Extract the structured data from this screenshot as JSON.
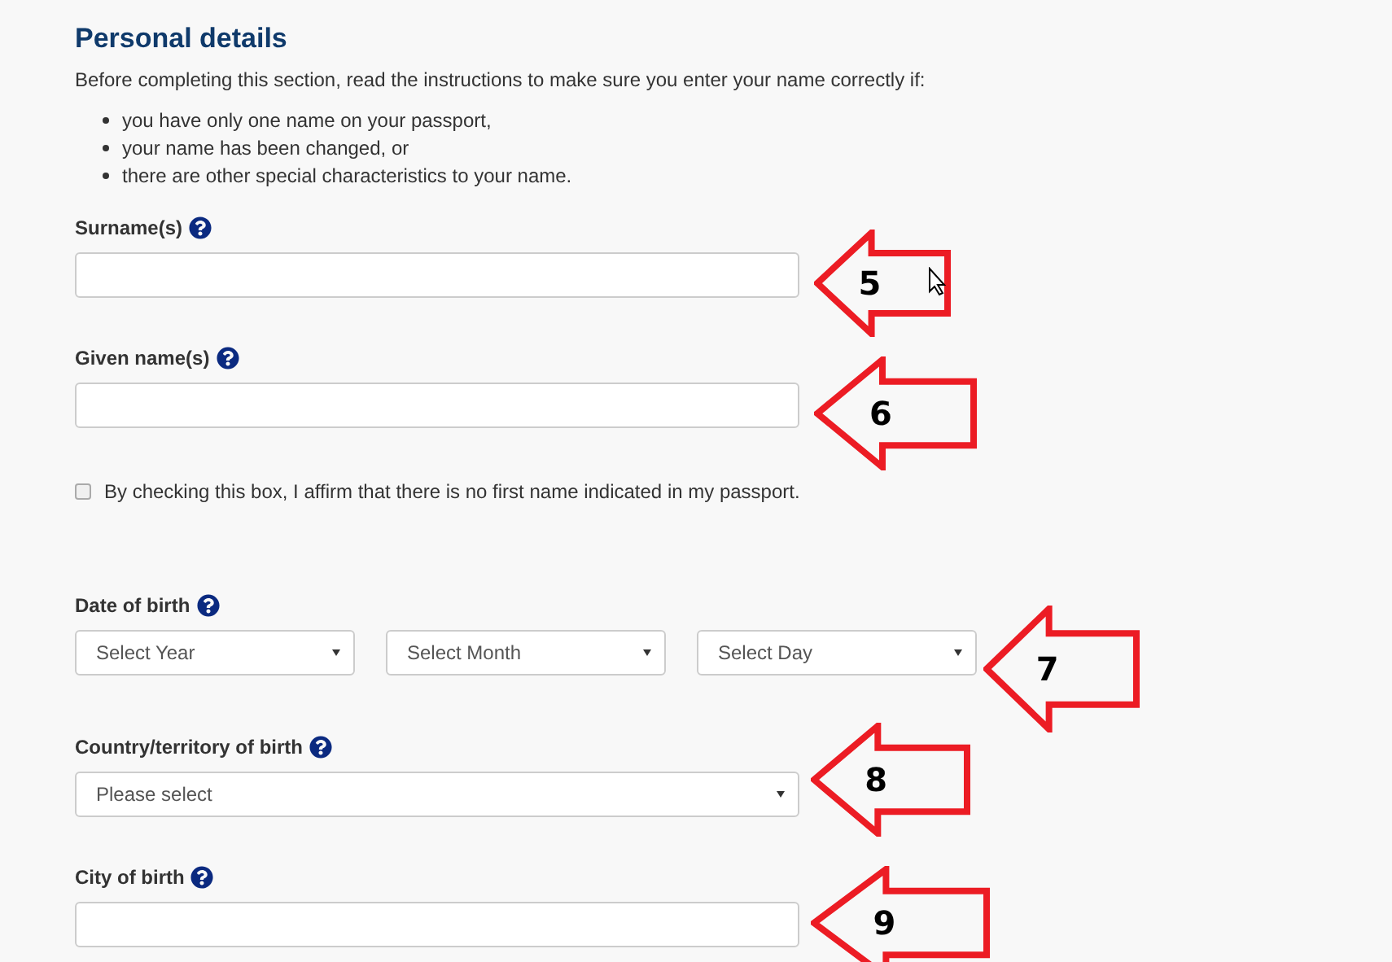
{
  "heading": "Personal details",
  "intro": "Before completing this section, read the instructions to make sure you enter your name correctly if:",
  "bullets": [
    "you have only one name on your passport,",
    "your name has been changed, or",
    "there are other special characteristics to your name."
  ],
  "fields": [
    {
      "kind": "text",
      "label": "Surname(s)",
      "annotation": "5"
    },
    {
      "kind": "text",
      "label": "Given name(s)",
      "annotation": "6"
    },
    {
      "kind": "checkbox",
      "label": "By checking this box, I affirm that there is no first name indicated in my passport.",
      "checked": false
    },
    {
      "kind": "date",
      "label": "Date of birth",
      "selects": [
        "Select Year",
        "Select Month",
        "Select Day"
      ],
      "annotation": "7"
    },
    {
      "kind": "select",
      "label": "Country/territory of birth",
      "placeholder": "Please select",
      "annotation": "8"
    },
    {
      "kind": "text",
      "label": "City of birth",
      "annotation": "9"
    }
  ]
}
